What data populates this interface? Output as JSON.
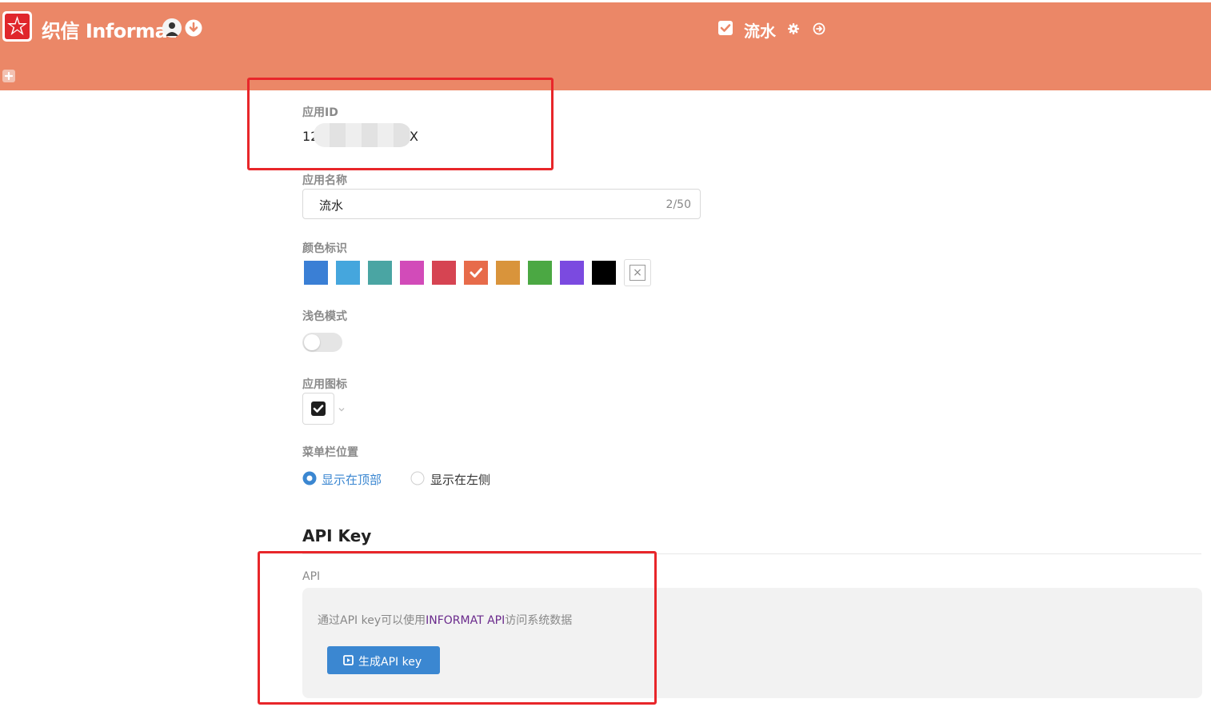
{
  "header": {
    "brand": "织信 Informat",
    "app_name": "流水",
    "colors": {
      "bar": "#eb8767"
    }
  },
  "settings": {
    "app_id": {
      "label": "应用ID",
      "prefix": "12",
      "suffix": "X"
    },
    "app_name": {
      "label": "应用名称",
      "value": "流水",
      "count": "2/50"
    },
    "color_tag": {
      "label": "颜色标识",
      "swatches": [
        "#3a7fd5",
        "#45a6dd",
        "#4aa5a3",
        "#d24bb9",
        "#d64452",
        "#e76b4a",
        "#d9943b",
        "#4ba843",
        "#7b4ae0",
        "#000000"
      ],
      "selected_index": 5
    },
    "light_mode": {
      "label": "浅色模式",
      "enabled": false
    },
    "app_icon": {
      "label": "应用图标",
      "icon": "checkbox-icon"
    },
    "menu_position": {
      "label": "菜单栏位置",
      "options": [
        "显示在顶部",
        "显示在左侧"
      ],
      "selected": "显示在顶部"
    }
  },
  "api_section": {
    "title": "API Key",
    "label": "API",
    "desc_prefix": "通过API key可以使用",
    "desc_link": "INFORMAT API",
    "desc_suffix": "访问系统数据",
    "button_label": "生成API key"
  }
}
